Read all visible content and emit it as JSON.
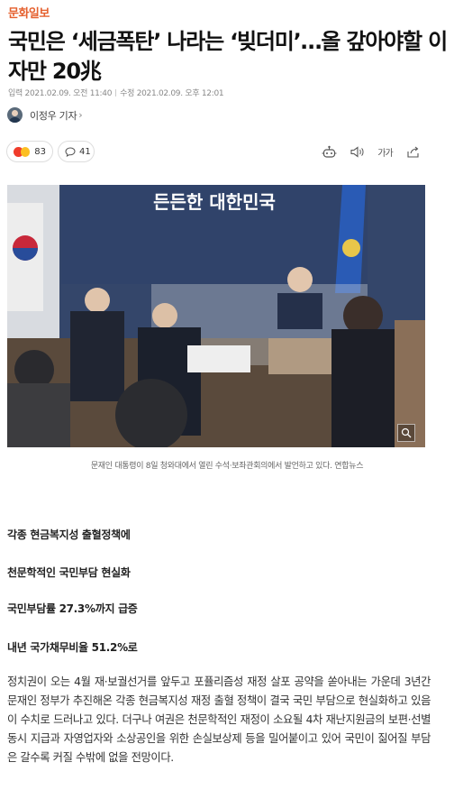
{
  "press": "문화일보",
  "headline": "국민은 ‘세금폭탄’ 나라는 ‘빚더미’…올 갚아야할 이자만 20兆",
  "dates": {
    "input_label": "입력",
    "input_value": "2021.02.09. 오전 11:40",
    "modified_label": "수정",
    "modified_value": "2021.02.09. 오후 12:01"
  },
  "reporter": {
    "name": "이정우 기자",
    "chevron": "›"
  },
  "reactions": {
    "count": "83"
  },
  "comments": {
    "count": "41"
  },
  "tools": {
    "font_size_label": "가가"
  },
  "photo": {
    "banner_text": "든든한 대한민국",
    "caption": "문재인 대통령이 8일 청와대에서 열린 수석·보좌관회의에서 발언하고 있다. 연합뉴스"
  },
  "subheads": [
    "각종 현금복지성 출혈정책에",
    "천문학적인 국민부담 현실화",
    "국민부담률 27.3%까지 급증",
    "내년 국가채무비율 51.2%로"
  ],
  "body": "정치권이 오는 4월 재·보궐선거를 앞두고 포퓰리즘성 재정 살포 공약을 쏟아내는 가운데 3년간 문재인 정부가 추진해온 각종 현금복지성 재정 출혈 정책이 결국 국민 부담으로 현실화하고 있음이 수치로 드러나고 있다. 더구나 여권은 천문학적인 재정이 소요될 4차 재난지원금의 보편·선별 동시 지급과 자영업자와 소상공인을 위한 손실보상제 등을 밀어붙이고 있어 국민이 짊어질 부담은 갈수록 커질 수밖에 없을 전망이다."
}
